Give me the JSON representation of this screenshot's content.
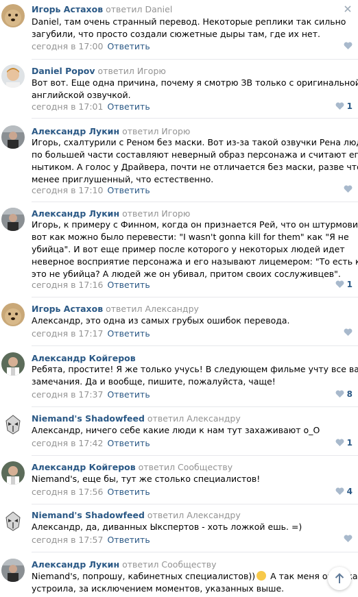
{
  "comments": [
    {
      "author": "Игорь Астахов",
      "replied_to": "ответил Daniel",
      "lines": [
        "Daniel, там очень странный перевод. Некоторые реплики так сильно",
        "загубили, что просто создали сюжетные дыры там, где их нет."
      ],
      "time": "сегодня в 17:00",
      "reply": "Ответить",
      "likes": ""
    },
    {
      "author": "Daniel Popov",
      "replied_to": "ответил Игорю",
      "lines": [
        "Вот вот. Еще одна причина, почему я смотрю ЗВ только с оригинальной",
        "английской озвучкой."
      ],
      "time": "сегодня в 17:01",
      "reply": "Ответить",
      "likes": "1"
    },
    {
      "author": "Александр Лукин",
      "replied_to": "ответил Игорю",
      "lines": [
        "Игорь, схалтурили с Реном без маски. Вот из-за такой озвучки Рена люди",
        "по большей части составляют неверный образ персонажа и считают его",
        "нытиком. А голос у Драйвера, почти не отличается без маски, разве что",
        "менее приглушенный, что естественно."
      ],
      "time": "сегодня в 17:10",
      "reply": "Ответить",
      "likes": ""
    },
    {
      "author": "Александр Лукин",
      "replied_to": "ответил Игорю",
      "lines": [
        "Игорь, к примеру с Финном, когда он признается Рей, что он штурмовик,",
        "вот как можно было перевести: \"I wasn't gonna kill for them\" как \"Я не",
        "убийца\". И вот еще пример после которого у некоторых людей идет",
        "неверное восприятие персонажа и его называют лицемером: \"То есть как",
        "это не убийца? А людей же он убивал, притом своих сослуживцев\"."
      ],
      "time": "сегодня в 17:16",
      "reply": "Ответить",
      "likes": "1"
    },
    {
      "author": "Игорь Астахов",
      "replied_to": "ответил Александру",
      "lines": [
        "Александр, это одна из самых грубых ошибок перевода."
      ],
      "time": "сегодня в 17:17",
      "reply": "Ответить",
      "likes": ""
    },
    {
      "author": "Александр Койгеров",
      "replied_to": "",
      "lines": [
        "Ребята, простите! Я же только учусь! В следующем фильме учту все ваши",
        "замечания. Да и вообще, пишите, пожалуйста, чаще!"
      ],
      "time": "сегодня в 17:37",
      "reply": "Ответить",
      "likes": "8"
    },
    {
      "author": "Niemand's Shadowfeed",
      "replied_to": "ответил Александру",
      "lines": [
        "Александр, ничего себе какие люди к нам тут захаживают о_О"
      ],
      "time": "сегодня в 17:42",
      "reply": "Ответить",
      "likes": "1"
    },
    {
      "author": "Александр Койгеров",
      "replied_to": "ответил Сообществу",
      "lines": [
        "Niemand's, еще бы, тут же столько специалистов!"
      ],
      "time": "сегодня в 17:56",
      "reply": "Ответить",
      "likes": "4"
    },
    {
      "author": "Niemand's Shadowfeed",
      "replied_to": "ответил Александру",
      "lines": [
        "Александр, да, диванных Ыкспертов - хоть ложкой ешь. =)"
      ],
      "time": "сегодня в 17:57",
      "reply": "Ответить",
      "likes": ""
    },
    {
      "author": "Александр Лукин",
      "replied_to": "ответил Сообществу",
      "lines_emoji_before": "Niemand's, попрошу, кабинетных специалистов))",
      "lines_emoji_after": " А так меня озвучка",
      "lines": [
        "устроила, за исключением моментов, указанных выше."
      ],
      "time": "",
      "reply": "",
      "likes": ""
    }
  ],
  "icons": {
    "close": "close-icon",
    "like": "heart-icon",
    "scroll_top": "arrow-up-icon"
  },
  "colors": {
    "author": "#2a5885",
    "muted": "#939393",
    "divider": "#e7e8ec",
    "like_heart": "#a8b9cc"
  }
}
